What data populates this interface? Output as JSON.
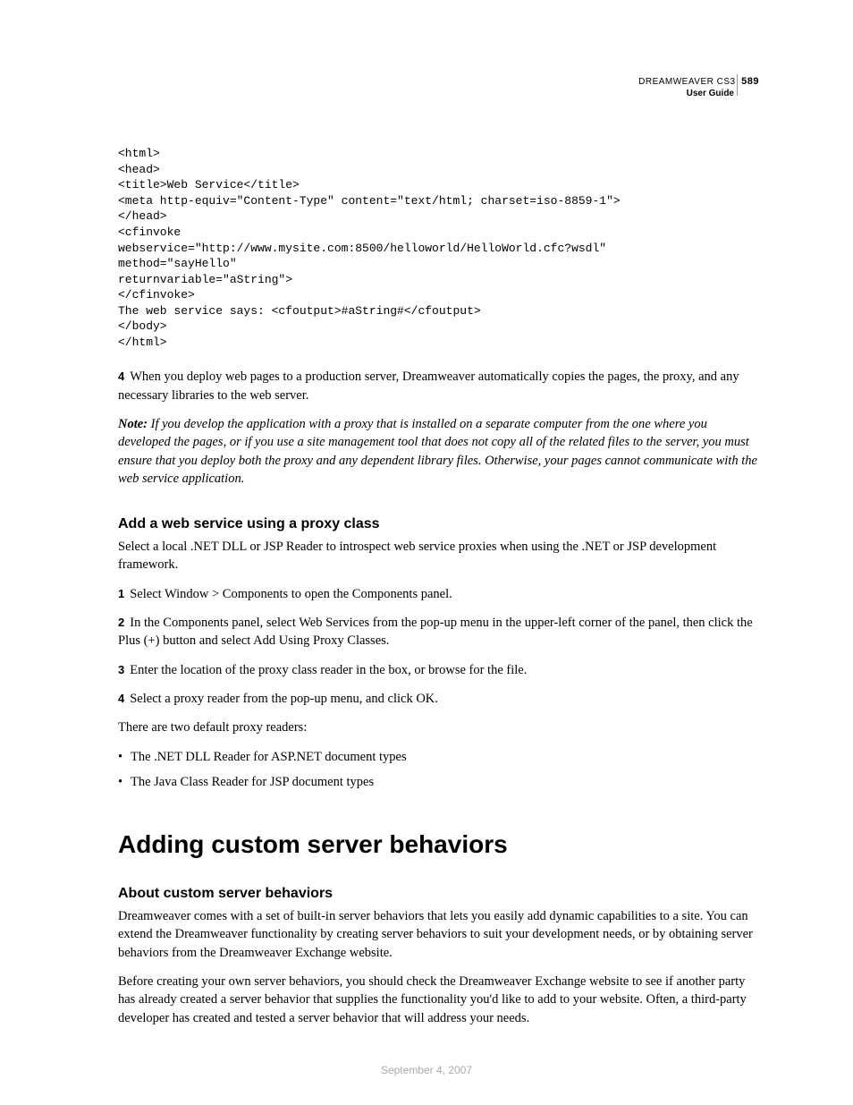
{
  "header": {
    "product": "DREAMWEAVER CS3",
    "pageNumber": "589",
    "subtitle": "User Guide"
  },
  "code": "<html>\n<head>\n<title>Web Service</title>\n<meta http-equiv=\"Content-Type\" content=\"text/html; charset=iso-8859-1\">\n</head>\n<cfinvoke\nwebservice=\"http://www.mysite.com:8500/helloworld/HelloWorld.cfc?wsdl\"\nmethod=\"sayHello\"\nreturnvariable=\"aString\">\n</cfinvoke>\nThe web service says: <cfoutput>#aString#</cfoutput>\n</body>\n</html>",
  "step4": {
    "num": "4",
    "text": "When you deploy web pages to a production server, Dreamweaver automatically copies the pages, the proxy, and any necessary libraries to the web server."
  },
  "note": {
    "label": "Note:",
    "text": " If you develop the application with a proxy that is installed on a separate computer from the one where you developed the pages, or if you use a site management tool that does not copy all of the related files to the server, you must ensure that you deploy both the proxy and any dependent library files. Otherwise, your pages cannot communicate with the web service application."
  },
  "section1": {
    "heading": "Add a web service using a proxy class",
    "intro": "Select a local .NET DLL or JSP Reader to introspect web service proxies when using the .NET or JSP development framework.",
    "steps": [
      {
        "num": "1",
        "text": "Select Window > Components to open the Components panel."
      },
      {
        "num": "2",
        "text": "In the Components panel, select Web Services from the pop-up menu in the upper-left corner of the panel, then click the Plus (+) button and select Add Using Proxy Classes."
      },
      {
        "num": "3",
        "text": "Enter the location of the proxy class reader in the box, or browse for the file."
      },
      {
        "num": "4",
        "text": "Select a proxy reader from the pop-up menu, and click OK."
      }
    ],
    "tail": "There are two default proxy readers:",
    "bullets": [
      "The .NET DLL Reader for ASP.NET document types",
      "The Java Class Reader for JSP document types"
    ]
  },
  "section2": {
    "heading": "Adding custom server behaviors",
    "subheading": "About custom server behaviors",
    "p1": "Dreamweaver comes with a set of built-in server behaviors that lets you easily add dynamic capabilities to a site. You can extend the Dreamweaver functionality by creating server behaviors to suit your development needs, or by obtaining server behaviors from the Dreamweaver Exchange website.",
    "p2": "Before creating your own server behaviors, you should check the Dreamweaver Exchange website to see if another party has already created a server behavior that supplies the functionality you'd like to add to your website. Often, a third-party developer has created and tested a server behavior that will address your needs."
  },
  "footer": "September 4, 2007"
}
